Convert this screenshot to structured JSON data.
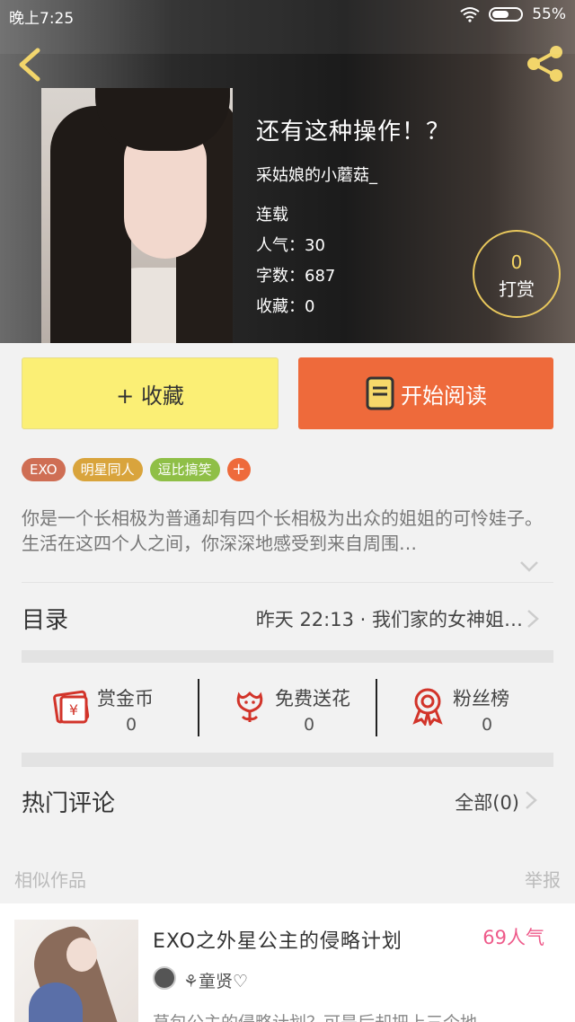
{
  "status_bar": {
    "time": "晚上7:25",
    "battery": "55%"
  },
  "book": {
    "title": "还有这种操作！？",
    "author": "采姑娘的小蘑菇_",
    "status": "连载",
    "popularity": "人气：30",
    "word_count": "字数：687",
    "favorites": "收藏：0"
  },
  "reward": {
    "count": "0",
    "label": "打赏"
  },
  "actions": {
    "collect": "+ 收藏",
    "read": "开始阅读"
  },
  "tags": [
    {
      "label": "EXO",
      "color": "#cf6e54"
    },
    {
      "label": "明星同人",
      "color": "#d9a43c"
    },
    {
      "label": "逗比搞笑",
      "color": "#8fbf47"
    }
  ],
  "tag_add": "+",
  "description": "你是一个长相极为普通却有四个长相极为出众的姐姐的可怜娃子。生活在这四个人之间，你深深地感受到来自周围…",
  "toc": {
    "label": "目录",
    "latest": "昨天 22:13 · 我们家的女神姐…"
  },
  "stats": [
    {
      "label": "赏金币",
      "value": "0",
      "icon": "red-envelope-icon"
    },
    {
      "label": "免费送花",
      "value": "0",
      "icon": "flower-icon"
    },
    {
      "label": "粉丝榜",
      "value": "0",
      "icon": "medal-icon"
    }
  ],
  "comments": {
    "label": "热门评论",
    "all": "全部(0)"
  },
  "similar": {
    "label": "相似作品",
    "report": "举报",
    "items": [
      {
        "title": "EXO之外星公主的侵略计划",
        "popularity": "69人气",
        "author": "⚘童贤♡",
        "summary": "草包公主的侵略计划？可是后却把上三个地"
      }
    ]
  },
  "colors": {
    "accent": "#ee6a3b",
    "collect": "#fbef75",
    "popularity": "#ee5a8a"
  }
}
